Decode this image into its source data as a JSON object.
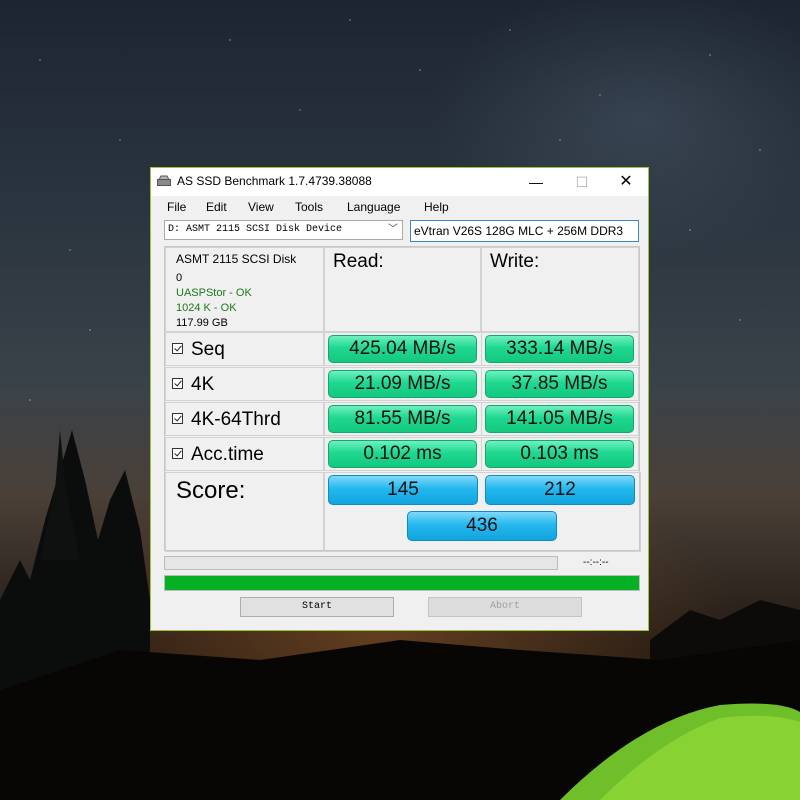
{
  "window": {
    "title": "AS SSD Benchmark 1.7.4739.38088",
    "min_glyph": "—",
    "max_glyph": "☐",
    "close_glyph": "✕"
  },
  "menu": [
    "File",
    "Edit",
    "View",
    "Tools",
    "Language",
    "Help"
  ],
  "drive": {
    "selected": "D: ASMT 2115 SCSI Disk Device",
    "model": "eVtran V26S 128G MLC + 256M DDR3"
  },
  "info": {
    "name": "ASMT 2115 SCSI Disk",
    "index": "0",
    "driver_status": "UASPStor - OK",
    "alignment_status": "1024 K - OK",
    "capacity": "117.99 GB"
  },
  "headers": {
    "read": "Read:",
    "write": "Write:"
  },
  "rows": [
    {
      "label": "Seq",
      "read": "425.04 MB/s",
      "write": "333.14 MB/s",
      "checked": true
    },
    {
      "label": "4K",
      "read": "21.09 MB/s",
      "write": "37.85 MB/s",
      "checked": true
    },
    {
      "label": "4K-64Thrd",
      "read": "81.55 MB/s",
      "write": "141.05 MB/s",
      "checked": true
    },
    {
      "label": "Acc.time",
      "read": "0.102 ms",
      "write": "0.103 ms",
      "checked": true
    }
  ],
  "score": {
    "label": "Score:",
    "read": "145",
    "write": "212",
    "total": "436"
  },
  "progress": {
    "time": "--:--:--",
    "main_fraction": 1.0,
    "test_fraction": 0.0
  },
  "buttons": {
    "start": "Start",
    "abort": "Abort"
  },
  "colors": {
    "result_green": "#1fd890",
    "score_blue": "#25b8ee",
    "progress_green": "#06b025",
    "status_ok": "#1a7a1a",
    "window_border": "#9cc43a"
  }
}
